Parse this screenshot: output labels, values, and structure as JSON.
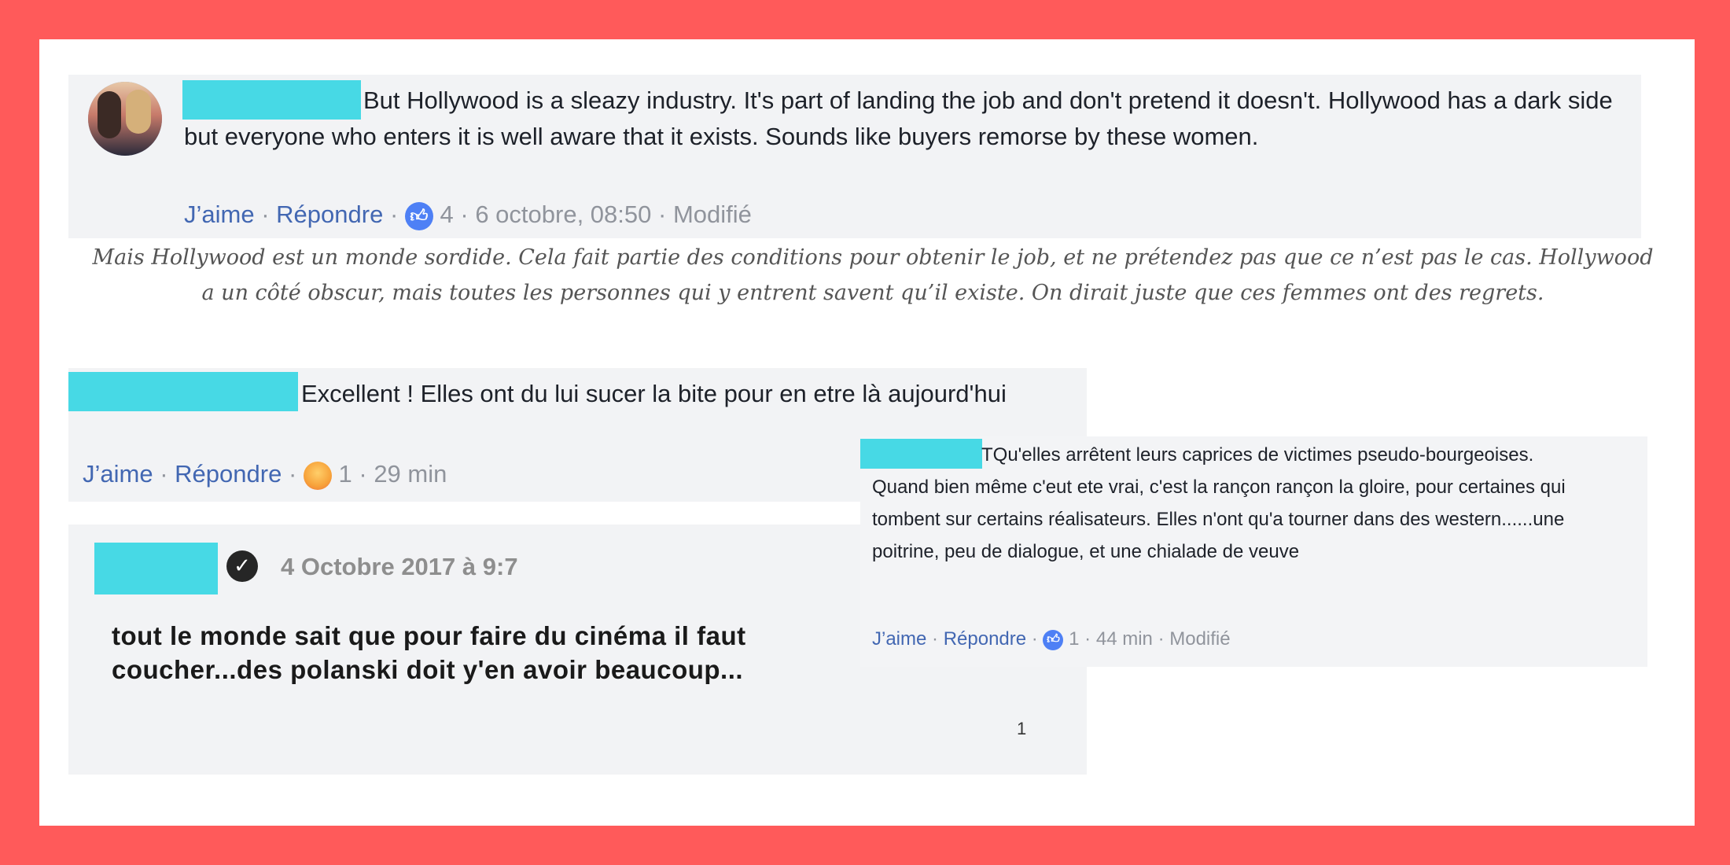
{
  "comment1": {
    "text": "But Hollywood is a sleazy industry. It's part of landing the job and don't pretend it doesn't. Hollywood has a dark side but everyone who enters it is well aware that it exists. Sounds like buyers remorse by these women.",
    "like": "J’aime",
    "reply": "Répondre",
    "reactions": "4",
    "date": "6 octobre, 08:50",
    "edited": "Modifié",
    "translation": "Mais Hollywood est un monde sordide. Cela fait partie des conditions pour obtenir le job, et ne prétendez pas que ce n’est pas le cas. Hollywood a un côté obscur, mais toutes les personnes qui y entrent savent qu’il existe. On dirait juste que ces femmes ont des regrets."
  },
  "comment2": {
    "text": "Excellent ! Elles ont du lui sucer la bite pour en etre là aujourd'hui",
    "like": "J’aime",
    "reply": "Répondre",
    "reactions": "1",
    "time": "29 min"
  },
  "comment3": {
    "date": "4 Octobre 2017 à 9:7",
    "text": "tout le monde sait que pour faire du cinéma il faut coucher...des polanski doit y'en avoir beaucoup...",
    "count": "1"
  },
  "comment4": {
    "text": "TQu'elles arrêtent leurs caprices de victimes pseudo-bourgeoises. Quand bien même c'eut ete vrai, c'est la rançon rançon la gloire, pour certaines qui tombent sur certains réalisateurs. Elles n'ont qu'a tourner dans des western......une poitrine, peu de dialogue, et une chialade de veuve",
    "like": "J’aime",
    "reply": "Répondre",
    "reactions": "1",
    "time": "44 min",
    "edited": "Modifié"
  },
  "colors": {
    "frame": "#ff5a5a",
    "redaction": "#47d9e5",
    "link": "#4267b2",
    "card": "#f2f3f5"
  }
}
